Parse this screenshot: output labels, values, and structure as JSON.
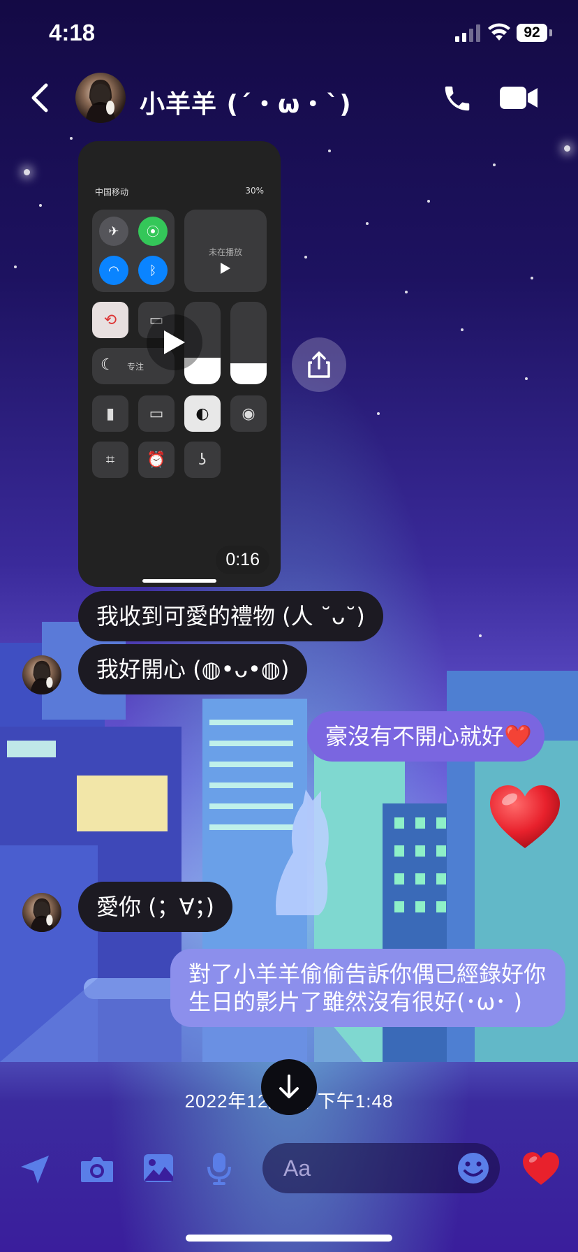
{
  "status_bar": {
    "time": "4:18",
    "battery": "92"
  },
  "header": {
    "contact_name": "小羊羊 (´・ω・`)"
  },
  "video_message": {
    "duration": "0:16",
    "cc_status_left": "中国移动",
    "cc_status_right": "30%",
    "now_playing_label": "未在播放",
    "focus_label": "专注"
  },
  "messages": [
    {
      "text": "我收到可愛的禮物 (人 ˘ᴗ˘)",
      "direction": "incoming"
    },
    {
      "text": "我好開心 (◍•ᴗ•◍)",
      "direction": "incoming"
    },
    {
      "text": "豪沒有不開心就好",
      "direction": "outgoing",
      "emoji": "❤️"
    },
    {
      "text": "愛你 (；∀；)",
      "direction": "incoming"
    },
    {
      "text": "對了小羊羊偷偷告訴你偶已經錄好你生日的影片了雖然沒有很好(･ω･ )",
      "direction": "outgoing"
    }
  ],
  "big_reaction": {
    "emoji": "❤️"
  },
  "timestamp": "2022年12月 日 下午1:48",
  "composer": {
    "placeholder": "Aa"
  },
  "colors": {
    "outgoing_bubble": "#7a66e0",
    "incoming_bubble": "#1c1a22",
    "heart": "#e8212c"
  }
}
